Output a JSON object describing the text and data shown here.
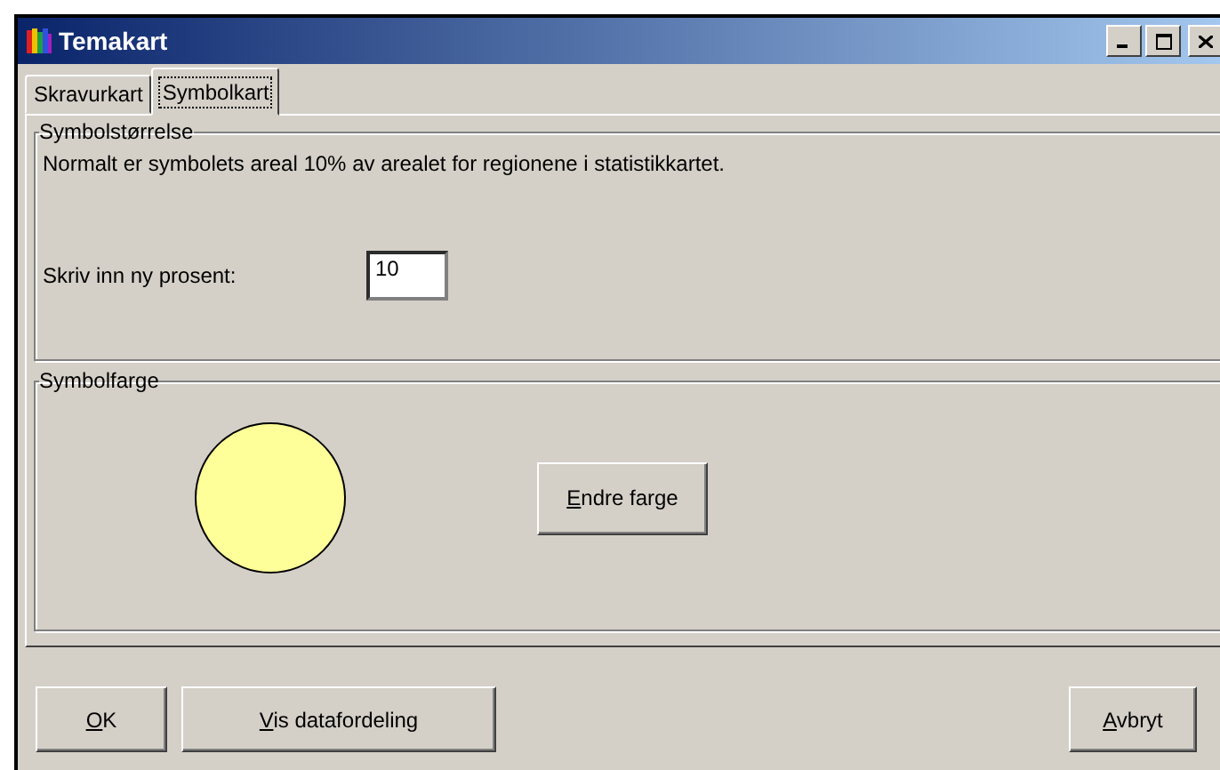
{
  "window": {
    "title": "Temakart"
  },
  "tabs": [
    {
      "label": "Skravurkart",
      "selected": false
    },
    {
      "label": "Symbolkart",
      "selected": true
    }
  ],
  "symbol_size": {
    "title": "Symbolstørrelse",
    "description": "Normalt er symbolets areal 10% av arealet for regionene i statistikkartet.",
    "field_label": "Skriv inn ny prosent:",
    "value": "10"
  },
  "symbol_color": {
    "title": "Symbolfarge",
    "color": "#ffff99",
    "button": "Endre farge"
  },
  "buttons": [
    "OK",
    "Vis datafordeling",
    "Avbryt"
  ]
}
